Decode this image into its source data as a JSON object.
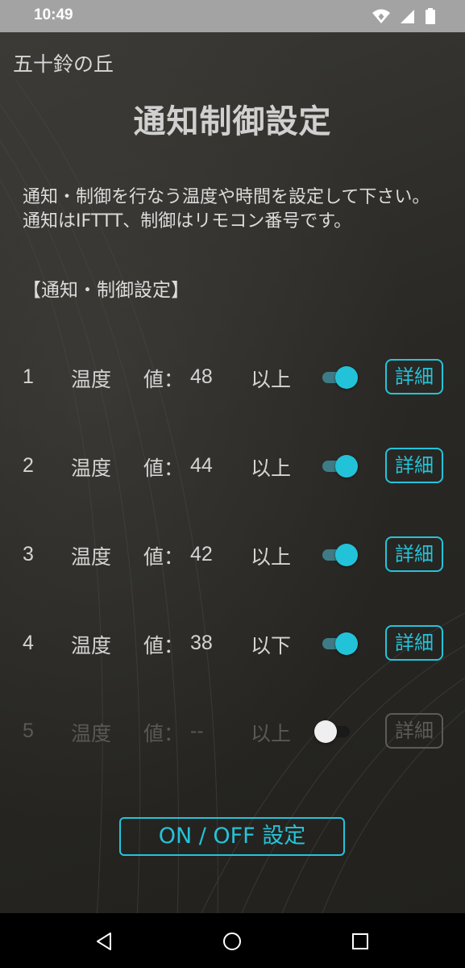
{
  "status_bar": {
    "time": "10:49",
    "icons": [
      "wifi-icon",
      "cell-signal-icon",
      "battery-icon"
    ]
  },
  "app_title": "五十鈴の丘",
  "page_heading": "通知制御設定",
  "description": "通知・制御を行なう温度や時間を設定して下さい。通知はIFTTT、制御はリモコン番号です。",
  "section_title": "【通知・制御設定】",
  "rules": [
    {
      "num": "1",
      "sensor": "温度",
      "value_label": "値：",
      "value": "48",
      "comparison": "以上",
      "enabled": true,
      "detail_label": "詳細"
    },
    {
      "num": "2",
      "sensor": "温度",
      "value_label": "値：",
      "value": "44",
      "comparison": "以上",
      "enabled": true,
      "detail_label": "詳細"
    },
    {
      "num": "3",
      "sensor": "温度",
      "value_label": "値：",
      "value": "42",
      "comparison": "以上",
      "enabled": true,
      "detail_label": "詳細"
    },
    {
      "num": "4",
      "sensor": "温度",
      "value_label": "値：",
      "value": "38",
      "comparison": "以下",
      "enabled": true,
      "detail_label": "詳細"
    },
    {
      "num": "5",
      "sensor": "温度",
      "value_label": "値：",
      "value": "--",
      "comparison": "以上",
      "enabled": false,
      "detail_label": "詳細"
    }
  ],
  "onoff_button_label": "ON / OFF 設定",
  "colors": {
    "accent": "#24c4da",
    "disabled": "#5c5b57",
    "text": "#d4d4d4"
  }
}
